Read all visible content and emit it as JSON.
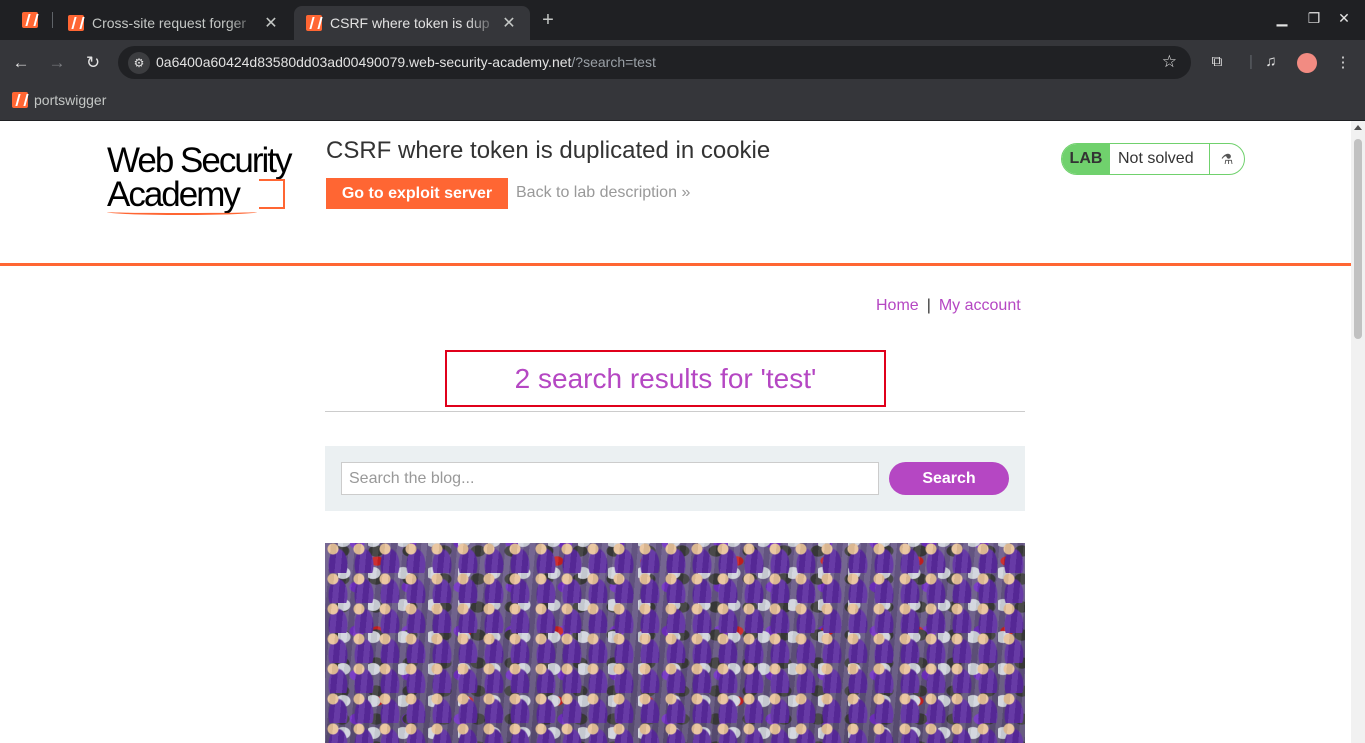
{
  "browser": {
    "tabs": [
      {
        "title": "Cross-site request forger",
        "active": false
      },
      {
        "title": "CSRF where token is dup",
        "active": true
      }
    ],
    "new_tab": "+",
    "url_host": "0a6400a60424d83580dd03ad00490079.web-security-academy.net",
    "url_path": "/?search=test",
    "bookmark": "portswigger"
  },
  "header": {
    "logo_line1": "Web Security",
    "logo_line2": "Academy",
    "lab_title": "CSRF where token is duplicated in cookie",
    "exploit_button": "Go to exploit server",
    "back_link": "Back to lab description",
    "back_chevron": "»",
    "lab_badge": "LAB",
    "lab_status": "Not solved"
  },
  "nav": {
    "home": "Home",
    "separator": "|",
    "account": "My account"
  },
  "results": {
    "heading": "2 search results for 'test'"
  },
  "search": {
    "placeholder": "Search the blog...",
    "button": "Search"
  },
  "colors": {
    "accent_orange": "#ff6633",
    "link_purple": "#b547c3",
    "lab_green": "#70d16d",
    "highlight_red": "#e0001b"
  }
}
